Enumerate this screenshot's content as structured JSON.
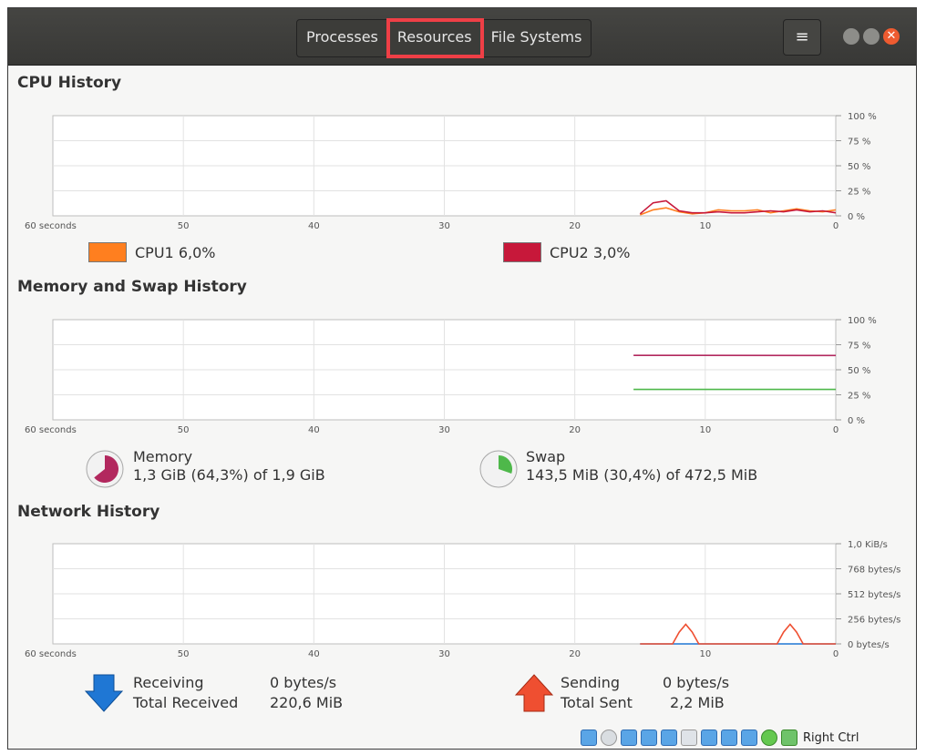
{
  "tabs": [
    {
      "label": "Processes"
    },
    {
      "label": "Resources"
    },
    {
      "label": "File Systems"
    }
  ],
  "menu_icon": "hamburger-menu-icon",
  "colors": {
    "titlebar": "#3c3c39",
    "active_tab_highlight": "#ef3f46",
    "cpu1": "#ff7f1f",
    "cpu2": "#c7183a",
    "memory": "#b2285e",
    "swap": "#4eb84a",
    "receiving": "#1f77d4",
    "sending": "#ef4f31"
  },
  "cpu": {
    "title": "CPU History",
    "cpu1_label": "CPU1",
    "cpu1_value": "6,0%",
    "cpu2_label": "CPU2",
    "cpu2_value": "3,0%"
  },
  "memory": {
    "title": "Memory and Swap History",
    "mem_label": "Memory",
    "mem_value": "1,3 GiB (64,3%) of 1,9 GiB",
    "mem_fraction": 0.643,
    "swap_label": "Swap",
    "swap_value": "143,5 MiB (30,4%) of 472,5 MiB",
    "swap_fraction": 0.304
  },
  "network": {
    "title": "Network History",
    "receiving_label": "Receiving",
    "receiving_value": "0 bytes/s",
    "total_received_label": "Total Received",
    "total_received_value": "220,6 MiB",
    "sending_label": "Sending",
    "sending_value": "0 bytes/s",
    "total_sent_label": "Total Sent",
    "total_sent_value": "2,2 MiB"
  },
  "statusbar": {
    "right_ctrl": "Right Ctrl"
  },
  "chart_data": [
    {
      "type": "line",
      "title": "CPU History",
      "x_ticks": [
        "60 seconds",
        "50",
        "40",
        "30",
        "20",
        "10",
        "0"
      ],
      "y_ticks": [
        "100 %",
        "75 %",
        "50 %",
        "25 %",
        "0 %"
      ],
      "ylim": [
        0,
        100
      ],
      "series": [
        {
          "name": "CPU1",
          "color": "#ff7f1f",
          "x": [
            15,
            14,
            13,
            12,
            11,
            10,
            9,
            8,
            7,
            6,
            5,
            4,
            3,
            2,
            1,
            0
          ],
          "y": [
            1,
            6,
            8,
            4,
            2,
            3,
            6,
            5,
            5,
            6,
            3,
            5,
            7,
            5,
            4,
            6
          ]
        },
        {
          "name": "CPU2",
          "color": "#c7183a",
          "x": [
            15,
            14,
            13,
            12,
            11,
            10,
            9,
            8,
            7,
            6,
            5,
            4,
            3,
            2,
            1,
            0
          ],
          "y": [
            2,
            13,
            15,
            5,
            3,
            3,
            4,
            3,
            3,
            4,
            5,
            4,
            6,
            4,
            5,
            3
          ]
        }
      ],
      "grid": true
    },
    {
      "type": "line",
      "title": "Memory and Swap History",
      "x_ticks": [
        "60 seconds",
        "50",
        "40",
        "30",
        "20",
        "10",
        "0"
      ],
      "y_ticks": [
        "100 %",
        "75 %",
        "50 %",
        "25 %",
        "0 %"
      ],
      "ylim": [
        0,
        100
      ],
      "series": [
        {
          "name": "Memory",
          "color": "#b2285e",
          "x": [
            15.5,
            0
          ],
          "y": [
            64.4,
            64.3
          ]
        },
        {
          "name": "Swap",
          "color": "#4eb84a",
          "x": [
            15.5,
            0
          ],
          "y": [
            30.4,
            30.4
          ]
        }
      ],
      "grid": true
    },
    {
      "type": "line",
      "title": "Network History",
      "x_ticks": [
        "60 seconds",
        "50",
        "40",
        "30",
        "20",
        "10",
        "0"
      ],
      "y_ticks": [
        "1,0 KiB/s",
        "768 bytes/s",
        "512 bytes/s",
        "256 bytes/s",
        "0 bytes/s"
      ],
      "ylim": [
        0,
        1024
      ],
      "series": [
        {
          "name": "Receiving",
          "color": "#1f77d4",
          "x": [
            15,
            0
          ],
          "y": [
            0,
            0
          ]
        },
        {
          "name": "Sending",
          "color": "#ef4f31",
          "x": [
            15,
            12.5,
            12,
            11.5,
            11,
            10.5,
            4.5,
            4,
            3.5,
            3,
            2.5,
            0
          ],
          "y": [
            0,
            0,
            120,
            200,
            120,
            0,
            0,
            120,
            200,
            120,
            0,
            0
          ]
        }
      ],
      "grid": true
    }
  ]
}
